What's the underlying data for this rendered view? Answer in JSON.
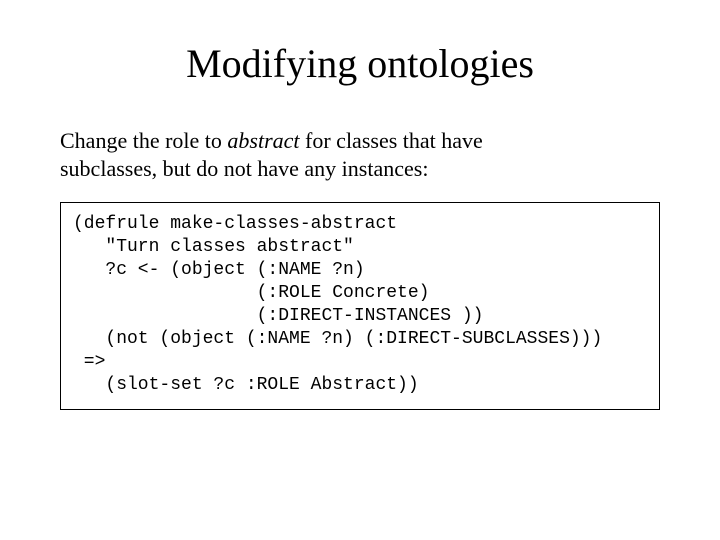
{
  "title": "Modifying ontologies",
  "description": {
    "prefix": "Change the role to ",
    "abstract": "abstract",
    "suffix": " for classes that have subclasses, but do not have any instances:"
  },
  "code": {
    "l1": "(defrule make-classes-abstract",
    "l2": "   \"Turn classes abstract\"",
    "l3": "   ?c <- (object (:NAME ?n)",
    "l4": "                 (:ROLE Concrete)",
    "l5": "                 (:DIRECT-INSTANCES ))",
    "l6": "   (not (object (:NAME ?n) (:DIRECT-SUBCLASSES)))",
    "l7": " =>",
    "l8": "   (slot-set ?c :ROLE Abstract))"
  }
}
